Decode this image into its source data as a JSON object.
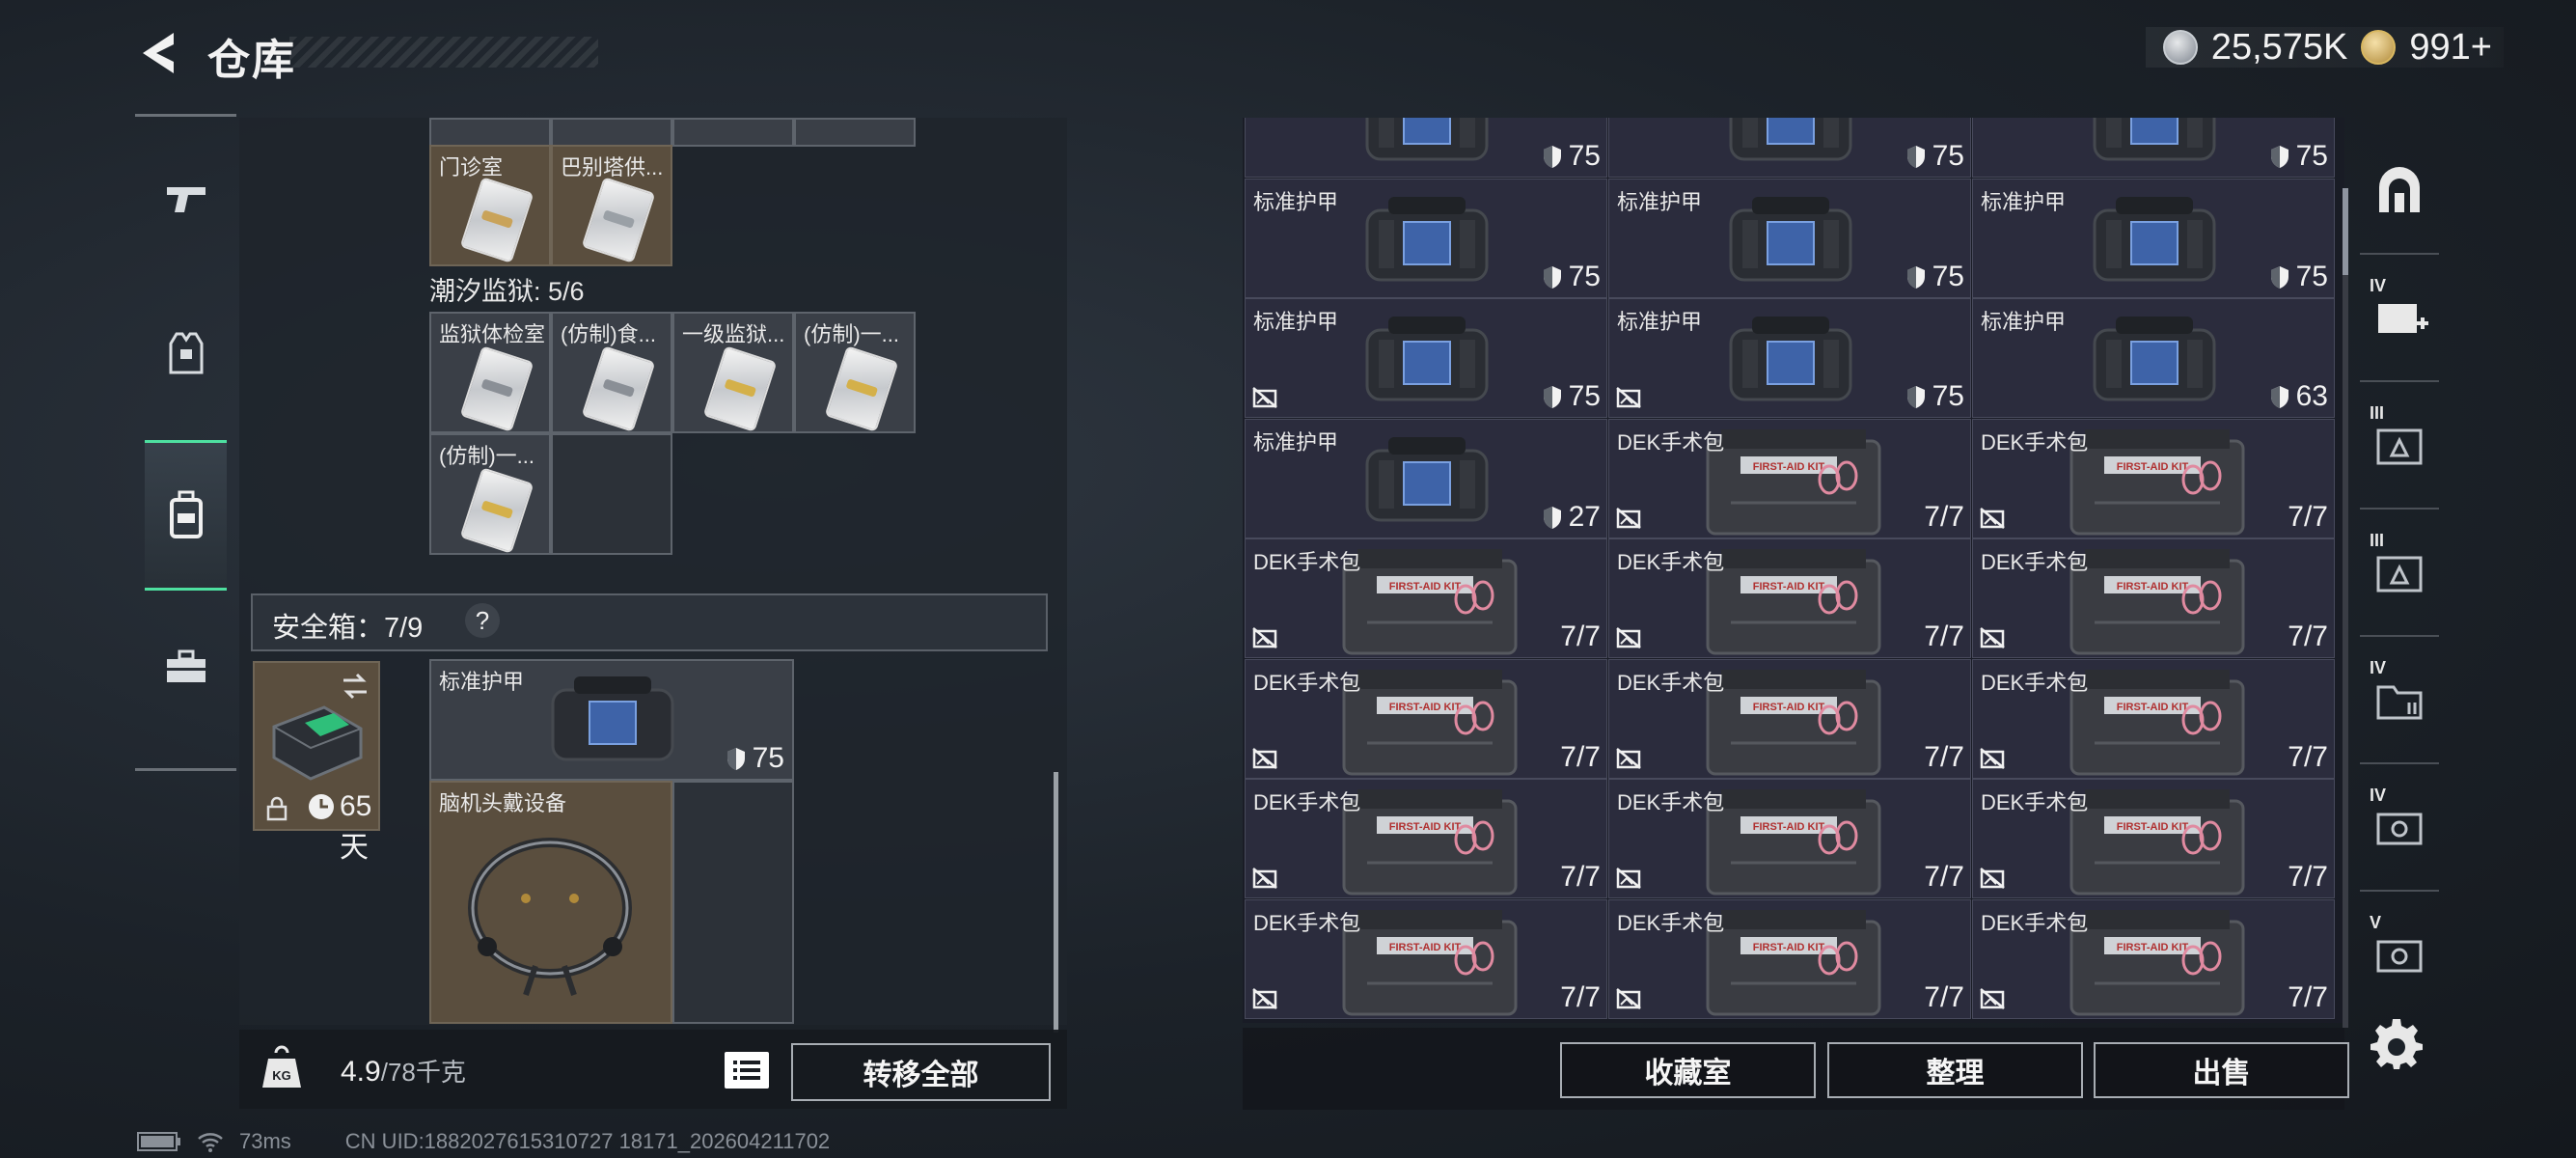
{
  "header": {
    "title": "仓库"
  },
  "currency": {
    "silver_value": "25,575K",
    "gold_value": "991+"
  },
  "left_nav": {
    "items": [
      "weapon-icon",
      "armor-vest-icon",
      "backpack-icon",
      "toolbox-icon"
    ]
  },
  "warehouse": {
    "row0": [
      {
        "label": "门诊室"
      },
      {
        "label": "巴别塔供..."
      }
    ],
    "tidal_prison": {
      "label": "潮汐监狱: 5/6"
    },
    "prison_cards": [
      {
        "label": "监狱体检室"
      },
      {
        "label": "(仿制)食..."
      },
      {
        "label": "一级监狱..."
      },
      {
        "label": "(仿制)一..."
      },
      {
        "label": "(仿制)一..."
      }
    ],
    "safe": {
      "label": "安全箱：7/9",
      "help": "?",
      "days": "65天"
    },
    "safe_items": [
      {
        "label": "标准护甲",
        "value": "75"
      },
      {
        "label": "脑机头戴设备"
      }
    ]
  },
  "bottom_left": {
    "weight_value": "4.9",
    "weight_limit": "/78千克",
    "transfer_all": "转移全部"
  },
  "stash": {
    "rows": [
      [
        {
          "label": "",
          "value": "75",
          "type": "armor"
        },
        {
          "label": "",
          "value": "75",
          "type": "armor"
        },
        {
          "label": "",
          "value": "75",
          "type": "armor"
        }
      ],
      [
        {
          "label": "标准护甲",
          "value": "75",
          "type": "armor"
        },
        {
          "label": "标准护甲",
          "value": "75",
          "type": "armor"
        },
        {
          "label": "标准护甲",
          "value": "75",
          "type": "armor"
        }
      ],
      [
        {
          "label": "标准护甲",
          "value": "75",
          "type": "armor",
          "noimg": true
        },
        {
          "label": "标准护甲",
          "value": "75",
          "type": "armor",
          "noimg": true
        },
        {
          "label": "标准护甲",
          "value": "63",
          "type": "armor"
        }
      ],
      [
        {
          "label": "标准护甲",
          "value": "27",
          "type": "armor"
        },
        {
          "label": "DEK手术包",
          "value": "7/7",
          "type": "kit",
          "noimg": true
        },
        {
          "label": "DEK手术包",
          "value": "7/7",
          "type": "kit",
          "noimg": true
        }
      ],
      [
        {
          "label": "DEK手术包",
          "value": "7/7",
          "type": "kit",
          "noimg": true
        },
        {
          "label": "DEK手术包",
          "value": "7/7",
          "type": "kit",
          "noimg": true
        },
        {
          "label": "DEK手术包",
          "value": "7/7",
          "type": "kit",
          "noimg": true
        }
      ],
      [
        {
          "label": "DEK手术包",
          "value": "7/7",
          "type": "kit",
          "noimg": true
        },
        {
          "label": "DEK手术包",
          "value": "7/7",
          "type": "kit",
          "noimg": true
        },
        {
          "label": "DEK手术包",
          "value": "7/7",
          "type": "kit",
          "noimg": true
        }
      ],
      [
        {
          "label": "DEK手术包",
          "value": "7/7",
          "type": "kit",
          "noimg": true
        },
        {
          "label": "DEK手术包",
          "value": "7/7",
          "type": "kit",
          "noimg": true
        },
        {
          "label": "DEK手术包",
          "value": "7/7",
          "type": "kit",
          "noimg": true
        }
      ],
      [
        {
          "label": "DEK手术包",
          "value": "7/7",
          "type": "kit",
          "noimg": true
        },
        {
          "label": "DEK手术包",
          "value": "7/7",
          "type": "kit",
          "noimg": true
        },
        {
          "label": "DEK手术包",
          "value": "7/7",
          "type": "kit",
          "noimg": true
        }
      ]
    ],
    "kit_text": "FIRST-AID KIT"
  },
  "right_buttons": {
    "collection": "收藏室",
    "sort": "整理",
    "sell": "出售"
  },
  "right_nav": {
    "tiers": [
      "",
      "IV",
      "III",
      "III",
      "IV",
      "IV",
      "V"
    ]
  },
  "status_bar": {
    "ping": "73ms",
    "uid": "CN UID:1882027615310727 18171_202604211702"
  },
  "colors": {
    "accent_green": "#4ee0a0",
    "panel_bg": "#2b2c3d",
    "brown_cell": "#5a4e3e"
  }
}
